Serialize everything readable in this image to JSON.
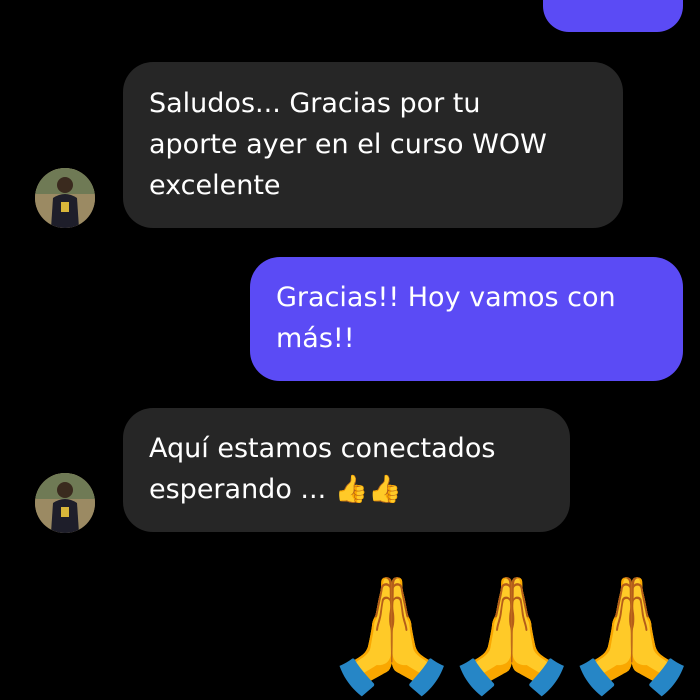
{
  "chat": {
    "messages": [
      {
        "direction": "incoming",
        "text": "Saludos... Gracias por tu\naporte ayer en el curso WOW\nexcelente"
      },
      {
        "direction": "outgoing",
        "text": "Gracias!! Hoy vamos con\nmás!!"
      },
      {
        "direction": "incoming",
        "text": "Aquí estamos conectados\nesperando ... 👍👍"
      }
    ],
    "final_emojis": [
      "🙏",
      "🙏",
      "🙏"
    ]
  },
  "colors": {
    "background": "#000000",
    "incoming_bubble": "#262626",
    "outgoing_bubble": "#5B4BF5",
    "text": "#FFFFFF"
  },
  "icons": {
    "avatar": "contact-avatar",
    "thumbs_up": "thumbs-up-emoji",
    "folded_hands": "folded-hands-emoji"
  }
}
